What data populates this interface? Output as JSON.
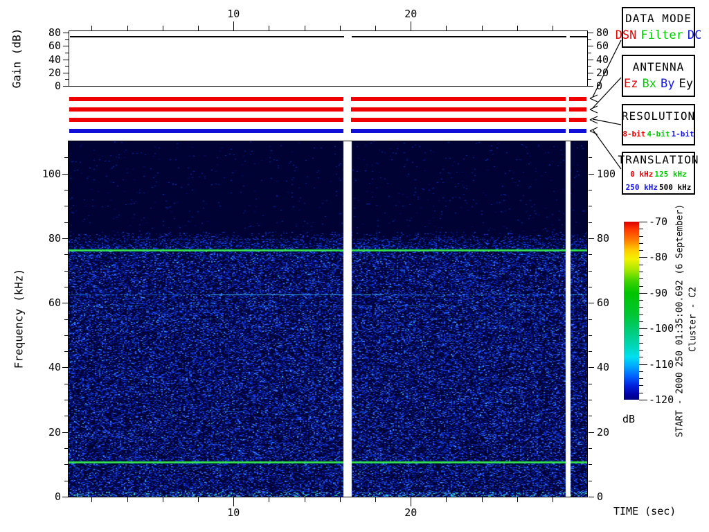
{
  "annotations": {
    "start": "START - 2000 250 01:35:00.692 (6 September)",
    "spacecraft": "Cluster - C2"
  },
  "gain_panel": {
    "ylabel": "Gain (dB)"
  },
  "spectrogram_axis": {
    "ylabel": "Frequency (kHz)"
  },
  "time_axis": {
    "label": "TIME (sec)",
    "major_tick_labels": [
      "10",
      "20"
    ]
  },
  "colorbar": {
    "unit": "dB",
    "tick_labels": [
      "-70",
      "-80",
      "-90",
      "-100",
      "-110",
      "-120"
    ],
    "gradient": [
      [
        "0",
        "#d80000"
      ],
      [
        "4",
        "#ff3300"
      ],
      [
        "10",
        "#ff7700"
      ],
      [
        "16",
        "#ffcc00"
      ],
      [
        "21",
        "#f2f200"
      ],
      [
        "27",
        "#a8e800"
      ],
      [
        "33",
        "#44d400"
      ],
      [
        "40",
        "#00c400"
      ],
      [
        "52",
        "#00c632"
      ],
      [
        "62",
        "#00cc7d"
      ],
      [
        "70",
        "#00d6b9"
      ],
      [
        "76",
        "#00dff0"
      ],
      [
        "81",
        "#00aaff"
      ],
      [
        "87",
        "#0060ff"
      ],
      [
        "92",
        "#0022dd"
      ],
      [
        "97",
        "#0000a8"
      ],
      [
        "100",
        "#000080"
      ]
    ]
  },
  "legend_boxes": [
    {
      "title": "DATA MODE",
      "size": "big",
      "lines": [
        [
          {
            "label": "DSN",
            "color": "#e60000"
          },
          {
            "label": "Filter",
            "color": "#00cc00"
          },
          {
            "label": "DC",
            "color": "#1414e6"
          }
        ]
      ]
    },
    {
      "title": "ANTENNA",
      "size": "big",
      "lines": [
        [
          {
            "label": "Ez",
            "color": "#e60000"
          },
          {
            "label": "Bx",
            "color": "#00cc00"
          },
          {
            "label": "By",
            "color": "#1414e6"
          },
          {
            "label": "Ey",
            "color": "#000000"
          }
        ]
      ]
    },
    {
      "title": "RESOLUTION",
      "size": "small",
      "lines": [
        [
          {
            "label": "8-bit",
            "color": "#e60000"
          },
          {
            "label": "4-bit",
            "color": "#00cc00"
          },
          {
            "label": "1-bit",
            "color": "#1414e6"
          }
        ]
      ]
    },
    {
      "title": "TRANSLATION",
      "size": "small",
      "lines": [
        [
          {
            "label": "0 kHz",
            "color": "#e60000"
          },
          {
            "label": "125 kHz",
            "color": "#00cc00"
          }
        ],
        [
          {
            "label": "250 kHz",
            "color": "#1414e6"
          },
          {
            "label": "500 kHz",
            "color": "#000000"
          }
        ]
      ]
    }
  ],
  "chart_data": {
    "type": "spectrogram",
    "title": "Cluster C2 WBD wideband spectrogram, start 2000-250 01:35:00.692 (6 September)",
    "x_axis": {
      "label": "TIME (sec)",
      "start": 0.692,
      "end": 29.92,
      "major_ticks": [
        10,
        20
      ],
      "minor_tick_step": 2
    },
    "y_axis": {
      "label": "Frequency (kHz)",
      "min": 0,
      "max": 110,
      "major_ticks": [
        0,
        20,
        40,
        60,
        80,
        100
      ],
      "minor_tick_step": 5
    },
    "z_axis": {
      "label": "dB",
      "min": -120,
      "max": -70,
      "major_ticks": [
        -70,
        -80,
        -90,
        -100,
        -110,
        -120
      ],
      "minor_tick_step": 2
    },
    "gain_axis": {
      "label": "Gain (dB)",
      "min": 0,
      "max": 80,
      "major_ticks": [
        0,
        20,
        40,
        60,
        80
      ],
      "minor_tick_step": 10
    },
    "gain_value_db": 75,
    "data_gaps_sec": [
      [
        16.2,
        16.62
      ],
      [
        28.72,
        28.95
      ]
    ],
    "status_bars": [
      {
        "name": "data-mode",
        "color": "#f00000",
        "meaning": "DSN"
      },
      {
        "name": "antenna",
        "color": "#f00000",
        "meaning": "Ez"
      },
      {
        "name": "resolution",
        "color": "#f00000",
        "meaning": "8-bit"
      },
      {
        "name": "translation",
        "color": "#1010d8",
        "meaning": "250 kHz"
      }
    ],
    "features": {
      "background": "dense blue broadband noise below ~77 kHz, near-black quiet band above ~82 kHz",
      "strong_narrowband_lines_khz": [
        76.3,
        10.8
      ],
      "strong_line_color": "#1fd23c",
      "weak_narrowband_lines_khz": [
        62.7,
        59.1,
        55.2,
        26.3
      ],
      "noise_floor_db": -120,
      "peak_db": -70
    }
  }
}
